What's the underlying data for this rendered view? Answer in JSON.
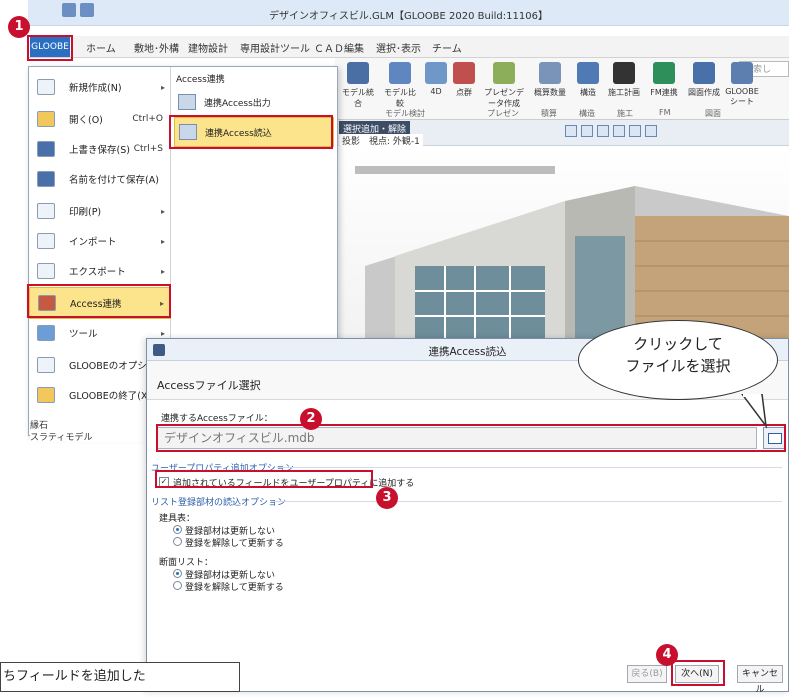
{
  "app": {
    "title": "デザインオフィスビル.GLM【GLOOBE 2020 Build:11106】",
    "tabs": [
      "GLOOBE",
      "ホーム",
      "敷地･外構",
      "建物設計",
      "専用設計ツール",
      "ＣＡＤ編集",
      "選択･表示",
      "チーム"
    ],
    "search_placeholder": "検索し"
  },
  "ribbon": {
    "buttons": [
      "モデル統合",
      "モデル比較",
      "4D",
      "点群",
      "プレゼンデータ作成",
      "概算数量",
      "構造",
      "施工計画",
      "FM連携",
      "図面作成",
      "GLOOBEシート"
    ],
    "groups": [
      "モデル検討",
      "プレゼン",
      "積算",
      "構造",
      "施工",
      "FM",
      "図面"
    ]
  },
  "view": {
    "tag": "選択追加・解除",
    "label": "投影　視点: 外観-1"
  },
  "menu": {
    "items": [
      {
        "label": "新規作成(N)",
        "shortcut": "",
        "arrow": "▸"
      },
      {
        "label": "開く(O)",
        "shortcut": "Ctrl+O",
        "arrow": ""
      },
      {
        "label": "上書き保存(S)",
        "shortcut": "Ctrl+S",
        "arrow": ""
      },
      {
        "label": "名前を付けて保存(A)",
        "shortcut": "",
        "arrow": ""
      },
      {
        "label": "印刷(P)",
        "shortcut": "",
        "arrow": "▸"
      },
      {
        "label": "インポート",
        "shortcut": "",
        "arrow": "▸"
      },
      {
        "label": "エクスポート",
        "shortcut": "",
        "arrow": "▸"
      },
      {
        "label": "Access連携",
        "shortcut": "",
        "arrow": "▸"
      },
      {
        "label": "ツール",
        "shortcut": "",
        "arrow": "▸"
      },
      {
        "label": "GLOOBEのオプション",
        "shortcut": "",
        "arrow": ""
      },
      {
        "label": "GLOOBEの終了(X)",
        "shortcut": "",
        "arrow": ""
      }
    ],
    "submenu_header": "Access連携",
    "submenu_items": [
      "連携Access出力",
      "連携Access読込"
    ]
  },
  "behind_list": [
    {
      "label": "縁石",
      "mark": "○"
    },
    {
      "label": "スラティモデル",
      "mark": "×"
    }
  ],
  "dialog": {
    "title": "連携Access読込",
    "heading": "Accessファイル選択",
    "file_label": "連携するAccessファイル：",
    "file_value": "デザインオフィスビル.mdb",
    "group_user": "ユーザープロパティ追加オプション",
    "check_label": "追加されているフィールドをユーザープロパティに追加する",
    "group_list": "リスト登録部材の読込オプション",
    "fixture_label": "建具表：",
    "fixture_options": [
      "登録部材は更新しない",
      "登録を解除して更新する"
    ],
    "section_label": "断面リスト：",
    "section_options": [
      "登録部材は更新しない",
      "登録を解除して更新する"
    ],
    "btn_back": "戻る(B)",
    "btn_next": "次へ(N)",
    "btn_cancel": "キャンセル"
  },
  "annotations": {
    "steps": [
      "1",
      "2",
      "3",
      "4"
    ],
    "callout": [
      "クリックして",
      "ファイルを選択"
    ],
    "note": "ちフィールドを追加した"
  },
  "colors": {
    "highlight": "#c8102e",
    "accent": "#2b6fc2",
    "menu_active": "#fce48c"
  }
}
